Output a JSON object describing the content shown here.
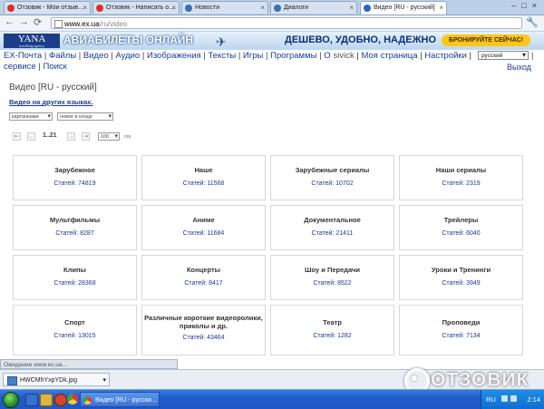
{
  "browser": {
    "tabs": [
      {
        "label": "Отзовик - Мои отзыв…",
        "fav_color": "#d9302a",
        "active": false
      },
      {
        "label": "Отзовик - Написать о…",
        "fav_color": "#d9302a",
        "active": false
      },
      {
        "label": "Новости",
        "fav_color": "#3a6fb0",
        "active": false
      },
      {
        "label": "Диалоги",
        "fav_color": "#3a6fb0",
        "active": false
      },
      {
        "label": "Видео [RU - русский]",
        "fav_color": "#2a62c8",
        "active": true
      }
    ],
    "url_host": "www.ex.ua",
    "url_path": "/ru/video"
  },
  "ad": {
    "logo_text": "YANA",
    "logo_sub": "travelling agency",
    "title": "АВИАБИЛЕТЫ ОНЛАЙН",
    "slogan": "ДЕШЕВО, УДОБНО, НАДЕЖНО",
    "button": "БРОНИРУЙТЕ СЕЙЧАС!"
  },
  "site_nav": {
    "items": [
      "EX-Почта",
      "Файлы",
      "Видео",
      "Аудио",
      "Изображения",
      "Тексты",
      "Игры",
      "Программы",
      "О"
    ],
    "row2": [
      "сервисе",
      "Поиск"
    ],
    "user": "sivick",
    "my_page": "Моя страница",
    "settings": "Настройки",
    "lang": "русский",
    "logout": "Выход"
  },
  "page": {
    "title": "Видео [RU - русский]",
    "other_langs": "Видео на других языках.",
    "view_select": "картинками",
    "sort_select": "новое в конце",
    "pager_range": "1..21",
    "per_page": "100",
    "rss": "rss"
  },
  "categories": [
    {
      "name": "Зарубежное",
      "count": "Статей: 74819"
    },
    {
      "name": "Наше",
      "count": "Статей: 11568"
    },
    {
      "name": "Зарубежные сериалы",
      "count": "Статей: 10702"
    },
    {
      "name": "Наши сериалы",
      "count": "Статей: 2319"
    },
    {
      "name": "Мультфильмы",
      "count": "Статей: 8287"
    },
    {
      "name": "Аниме",
      "count": "Статей: 11684"
    },
    {
      "name": "Документальное",
      "count": "Статей: 21411"
    },
    {
      "name": "Трейлеры",
      "count": "Статей: 6040"
    },
    {
      "name": "Клипы",
      "count": "Статей: 28368"
    },
    {
      "name": "Концерты",
      "count": "Статей: 8417"
    },
    {
      "name": "Шоу и Передачи",
      "count": "Статей: 8522"
    },
    {
      "name": "Уроки и Тренинги",
      "count": "Статей: 3949"
    },
    {
      "name": "Спорт",
      "count": "Статей: 13015"
    },
    {
      "name": "Различные короткие видеоролики, приколы и др.",
      "count": "Статей: 43464"
    },
    {
      "name": "Театр",
      "count": "Статей: 1282"
    },
    {
      "name": "Проповеди",
      "count": "Статей: 7134"
    }
  ],
  "status_text": "Ожидание www.ex.ua...",
  "download": {
    "file": "HWCMhYxpYDk.jpg"
  },
  "watermark": "ОТЗОВИК",
  "taskbar": {
    "task_label": "Видео [RU - русски...",
    "lang": "RU",
    "time": "2:14"
  }
}
